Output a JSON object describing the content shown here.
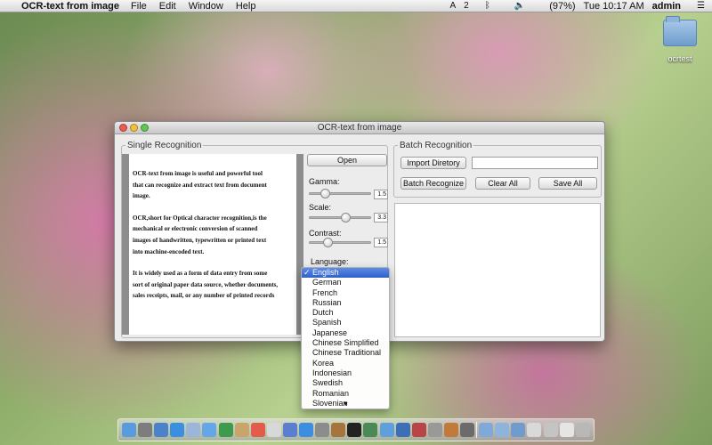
{
  "menubar": {
    "app_name": "OCR-text from image",
    "menus": [
      "File",
      "Edit",
      "Window",
      "Help"
    ],
    "status": {
      "adobe": "A",
      "badge": "2",
      "battery": "(97%)",
      "clock": "Tue 10:17 AM",
      "user": "admin"
    }
  },
  "desktop": {
    "folder_label": "ocrtest"
  },
  "window": {
    "title": "OCR-text from image",
    "single": {
      "legend": "Single Recognition",
      "open_button": "Open",
      "gamma": {
        "label": "Gamma:",
        "value": "1.5",
        "level": 0.2
      },
      "scale": {
        "label": "Scale:",
        "value": "3.3",
        "level": 0.6
      },
      "contrast": {
        "label": "Contrast:",
        "value": "1.5",
        "level": 0.25
      },
      "language_label": "Language:",
      "preview_paragraphs": [
        [
          "OCR-text from image is useful and powerful tool",
          "that can recognize and extract text from document",
          "image."
        ],
        [
          "OCR,short for Optical character recognition,is the",
          "mechanical or electronic conversion of scanned",
          "images of handwritten, typewritten or printed text",
          "into machine-encoded text."
        ],
        [
          "It is widely used as a form of data entry from some",
          "sort of original paper data source, whether documents,",
          "sales receipts, mail, or any number of printed records"
        ]
      ]
    },
    "batch": {
      "legend": "Batch Recognition",
      "import_button": "Import Diretory",
      "path_value": "",
      "batch_recognize_button": "Batch Recognize",
      "clear_all_button": "Clear All",
      "save_all_button": "Save All"
    }
  },
  "language_menu": {
    "selected": "English",
    "items": [
      "English",
      "German",
      "French",
      "Russian",
      "Dutch",
      "Spanish",
      "Japanese",
      "Chinese Simplified",
      "Chinese Traditional",
      "Korea",
      "Indonesian",
      "Swedish",
      "Romanian",
      "Slovenian"
    ]
  },
  "dock": {
    "icons": [
      "finder-icon",
      "launchpad-icon",
      "system-icon",
      "safari-icon",
      "mail-icon",
      "messages-icon",
      "facetime-icon",
      "contacts-icon",
      "calendar-icon",
      "photos-icon",
      "itunes-icon",
      "app-store-icon",
      "preferences-icon",
      "book-icon",
      "terminal-icon",
      "time-machine-icon",
      "preview-icon",
      "xcode-icon",
      "ocr-app-icon",
      "utility-icon",
      "app-icon-a",
      "app-icon-b"
    ],
    "stack_icons": [
      "folder-applications-icon",
      "folder-documents-icon",
      "folder-downloads-icon",
      "stack-icon-a",
      "stack-icon-b",
      "stack-icon-c",
      "trash-icon"
    ]
  }
}
